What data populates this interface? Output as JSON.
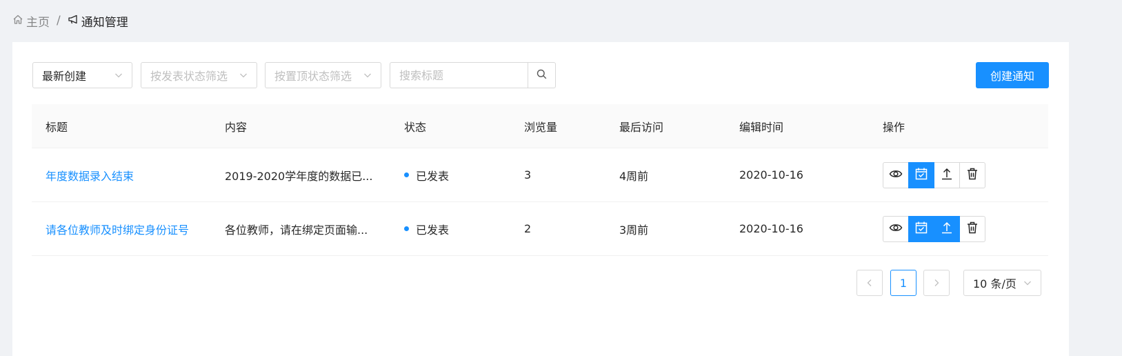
{
  "breadcrumb": {
    "home": "主页",
    "separator": "/",
    "current": "通知管理",
    "home_icon": "home-icon",
    "current_icon": "megaphone-icon"
  },
  "toolbar": {
    "order_select": "最新创建",
    "publish_filter_placeholder": "按发表状态筛选",
    "pin_filter_placeholder": "按置顶状态筛选",
    "search_placeholder": "搜索标题",
    "create_button": "创建通知"
  },
  "table": {
    "columns": [
      "标题",
      "内容",
      "状态",
      "浏览量",
      "最后访问",
      "编辑时间",
      "操作"
    ],
    "rows": [
      {
        "title": "年度数据录入结束",
        "content": "2019-2020学年度的数据已...",
        "status": "已发表",
        "views": "3",
        "last_visit": "4周前",
        "edit_time": "2020-10-16",
        "actions": [
          {
            "icon": "eye-icon",
            "active": false
          },
          {
            "icon": "calendar-check-icon",
            "active": true
          },
          {
            "icon": "upload-icon",
            "active": false
          },
          {
            "icon": "trash-icon",
            "active": false
          }
        ]
      },
      {
        "title": "请各位教师及时绑定身份证号",
        "content": "各位教师，请在绑定页面输...",
        "status": "已发表",
        "views": "2",
        "last_visit": "3周前",
        "edit_time": "2020-10-16",
        "actions": [
          {
            "icon": "eye-icon",
            "active": false
          },
          {
            "icon": "calendar-check-icon",
            "active": true
          },
          {
            "icon": "upload-icon",
            "active": true
          },
          {
            "icon": "trash-icon",
            "active": false
          }
        ]
      }
    ]
  },
  "pagination": {
    "current_page": "1",
    "page_size": "10 条/页"
  },
  "colors": {
    "primary": "#1890ff",
    "background": "#f0f2f5",
    "border": "#d9d9d9"
  }
}
